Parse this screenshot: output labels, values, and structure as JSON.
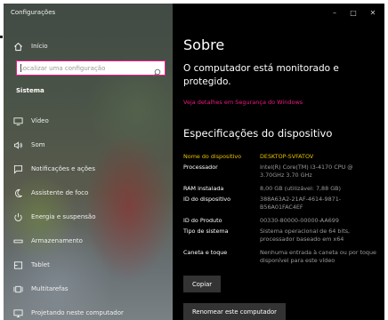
{
  "window": {
    "title": "Configurações"
  },
  "controls": {
    "minimize": "–",
    "maximize": "□",
    "close": "✕"
  },
  "sidebar": {
    "home": {
      "label": "Início",
      "icon": "home-icon"
    },
    "search": {
      "placeholder": "Localizar uma configuração",
      "icon": "search-icon"
    },
    "section": "Sistema",
    "items": [
      {
        "label": "Vídeo",
        "icon": "monitor-icon"
      },
      {
        "label": "Som",
        "icon": "speaker-icon"
      },
      {
        "label": "Notificações e ações",
        "icon": "notification-icon"
      },
      {
        "label": "Assistente de foco",
        "icon": "moon-icon"
      },
      {
        "label": "Energia e suspensão",
        "icon": "power-icon"
      },
      {
        "label": "Armazenamento",
        "icon": "storage-icon"
      },
      {
        "label": "Tablet",
        "icon": "tablet-icon"
      },
      {
        "label": "Multitarefas",
        "icon": "multitasking-icon"
      },
      {
        "label": "Projetando neste computador",
        "icon": "projector-icon"
      }
    ]
  },
  "main": {
    "title": "Sobre",
    "status": "O computador está monitorado e protegido.",
    "security_link": "Veja detalhes em Segurança do Windows",
    "spec_title": "Especificações do dispositivo",
    "specs": [
      {
        "key": "Nome do dispositivo",
        "value": "DESKTOP-SVFATOV"
      },
      {
        "key": "Processador",
        "value": "Intel(R) Core(TM) i3-4170 CPU @ 3.70GHz   3.70 GHz"
      },
      {
        "key": "RAM instalada",
        "value": "8,00 GB (utilizável: 7,88 GB)"
      },
      {
        "key": "ID do dispositivo",
        "value": "388A63A2-21AF-4614-9871-B56A01FAC4EF"
      },
      {
        "key": "ID do Produto",
        "value": "00330-80000-00000-AA699"
      },
      {
        "key": "Tipo de sistema",
        "value": "Sistema operacional de 64 bits, processador baseado em x64"
      },
      {
        "key": "Caneta e toque",
        "value": "Nenhuma entrada à caneta ou por toque disponível para este vídeo"
      }
    ],
    "copy_button": "Copiar",
    "rename_button": "Renomear este computador"
  },
  "colors": {
    "accent": "#e81d8d",
    "link": "#f0197f",
    "highlight": "#e6c100"
  }
}
